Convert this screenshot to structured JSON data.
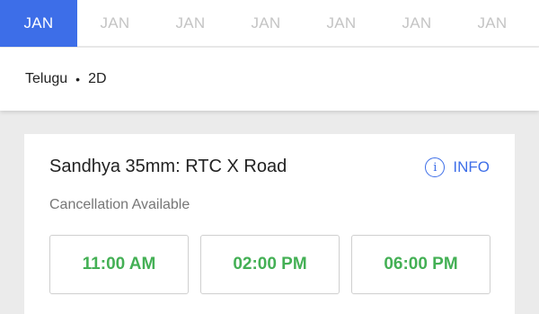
{
  "dates": [
    "JAN",
    "JAN",
    "JAN",
    "JAN",
    "JAN",
    "JAN",
    "JAN"
  ],
  "format": {
    "language": "Telugu",
    "separator": "•",
    "dimension": "2D"
  },
  "theatre": {
    "name": "Sandhya 35mm: RTC X Road",
    "info_label": "INFO",
    "info_icon": "i",
    "cancellation": "Cancellation Available",
    "showtimes": [
      "11:00 AM",
      "02:00 PM",
      "06:00 PM"
    ]
  },
  "colors": {
    "accent": "#3d6ee8",
    "available": "#44b055"
  }
}
